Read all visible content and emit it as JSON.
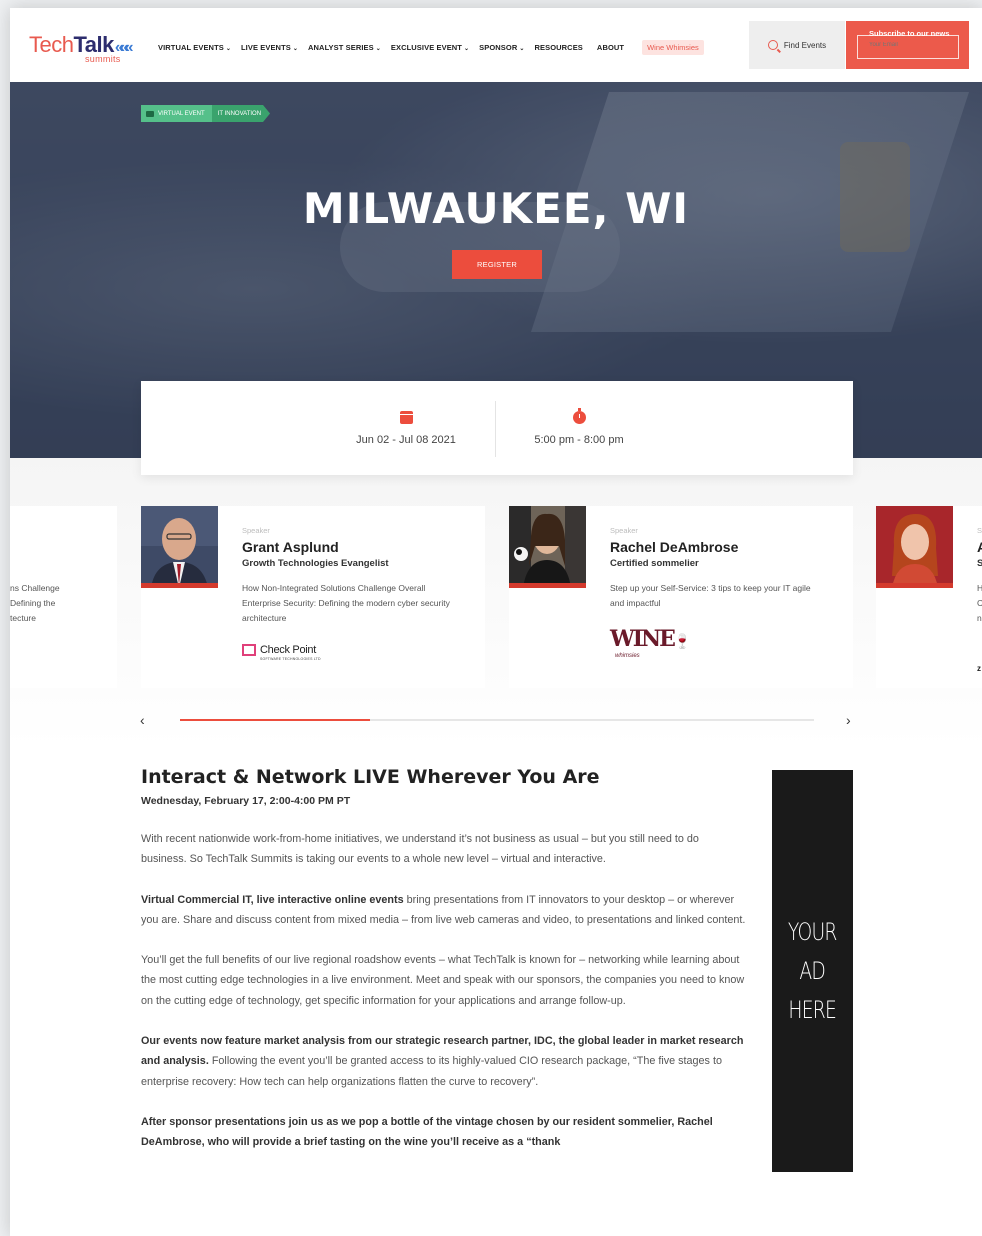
{
  "brand": {
    "name_light": "Tech",
    "name_bold": "Talk",
    "sub": "summits",
    "logo_color": "#e85a4f"
  },
  "nav": {
    "items": [
      {
        "label": "VIRTUAL EVENTS",
        "dropdown": true
      },
      {
        "label": "LIVE EVENTS",
        "dropdown": true
      },
      {
        "label": "ANALYST SERIES",
        "dropdown": true
      },
      {
        "label": "EXCLUSIVE EVENT",
        "dropdown": true
      },
      {
        "label": "SPONSOR",
        "dropdown": true
      },
      {
        "label": "RESOURCES",
        "dropdown": false
      },
      {
        "label": "ABOUT",
        "dropdown": false
      }
    ],
    "highlight": "Wine Whimsies"
  },
  "header": {
    "find_events": "Find Events",
    "subscribe_title": "Subscribe to our news",
    "subscribe_placeholder": "Your Email"
  },
  "hero": {
    "tags": [
      "VIRTUAL EVENT",
      "IT INNOVATION"
    ],
    "title": "MILWAUKEE, WI",
    "register": "REGISTER",
    "dates": "Jun 02 - Jul 08 2021",
    "time": "5:00 pm - 8:00 pm"
  },
  "speakers": [
    {
      "kicker": "Speaker",
      "name": "Grant Asplund",
      "role": "Growth Technologies Evangelist",
      "talk": "How Non-Integrated Solutions Challenge Overall Enterprise Security: Defining the modern cyber security architecture",
      "sponsor": "Check Point",
      "sponsor_sub": "SOFTWARE TECHNOLOGIES LTD"
    },
    {
      "kicker": "Speaker",
      "name": "Rachel DeAmbrose",
      "role": "Certified sommelier",
      "talk": "Step up your Self-Service: 3 tips to keep your IT agile and impactful",
      "sponsor": "WINE",
      "sponsor_sub": "whimsies"
    }
  ],
  "partial_left": {
    "talk_lines": [
      "ns Challenge",
      " Defining the",
      "tecture"
    ]
  },
  "partial_right": {
    "kicker": "S",
    "name": "A",
    "role": "S",
    "talk": [
      "H",
      "C",
      "n"
    ],
    "logo": "z"
  },
  "carousel": {
    "progress": 0.3
  },
  "article": {
    "title": "Interact & Network LIVE Wherever You Are",
    "date": "Wednesday, February 17, 2:00-4:00 PM PT",
    "p1": "With recent nationwide work-from-home initiatives, we understand it’s not business as usual – but you still need to do business. So TechTalk Summits is taking our events to a whole new level – virtual and interactive.",
    "p2_bold": "Virtual Commercial IT, live interactive online events",
    "p2": " bring presentations from IT innovators to your desktop – or wherever you are. Share and discuss content from mixed media – from live web cameras and video, to presentations and linked content.",
    "p3": "You’ll get the full benefits of our live regional roadshow events – what TechTalk is known for – networking while learning about the most cutting edge technologies in a live environment. Meet and speak with our sponsors, the companies you need to know on the cutting edge of technology, get specific information for your applications and arrange follow-up.",
    "p4_bold": "Our events now feature market analysis from our strategic research partner, IDC, the global leader in market research and analysis.",
    "p4": " Following the event you’ll be granted access to its highly-valued CIO research package, “The five stages to enterprise recovery: How tech can help organizations flatten the curve to recovery”.",
    "p5": "After sponsor presentations join us as we pop a bottle of the vintage chosen by our resident sommelier, Rachel DeAmbrose, who will provide a brief tasting on the wine you’ll receive as a “thank"
  },
  "ad": {
    "lines": [
      "YOUR",
      "AD",
      "HERE"
    ]
  },
  "colors": {
    "accent": "#ec4d3d",
    "tag_green": "#55c08a",
    "ad_bg": "#1a1a1a"
  }
}
